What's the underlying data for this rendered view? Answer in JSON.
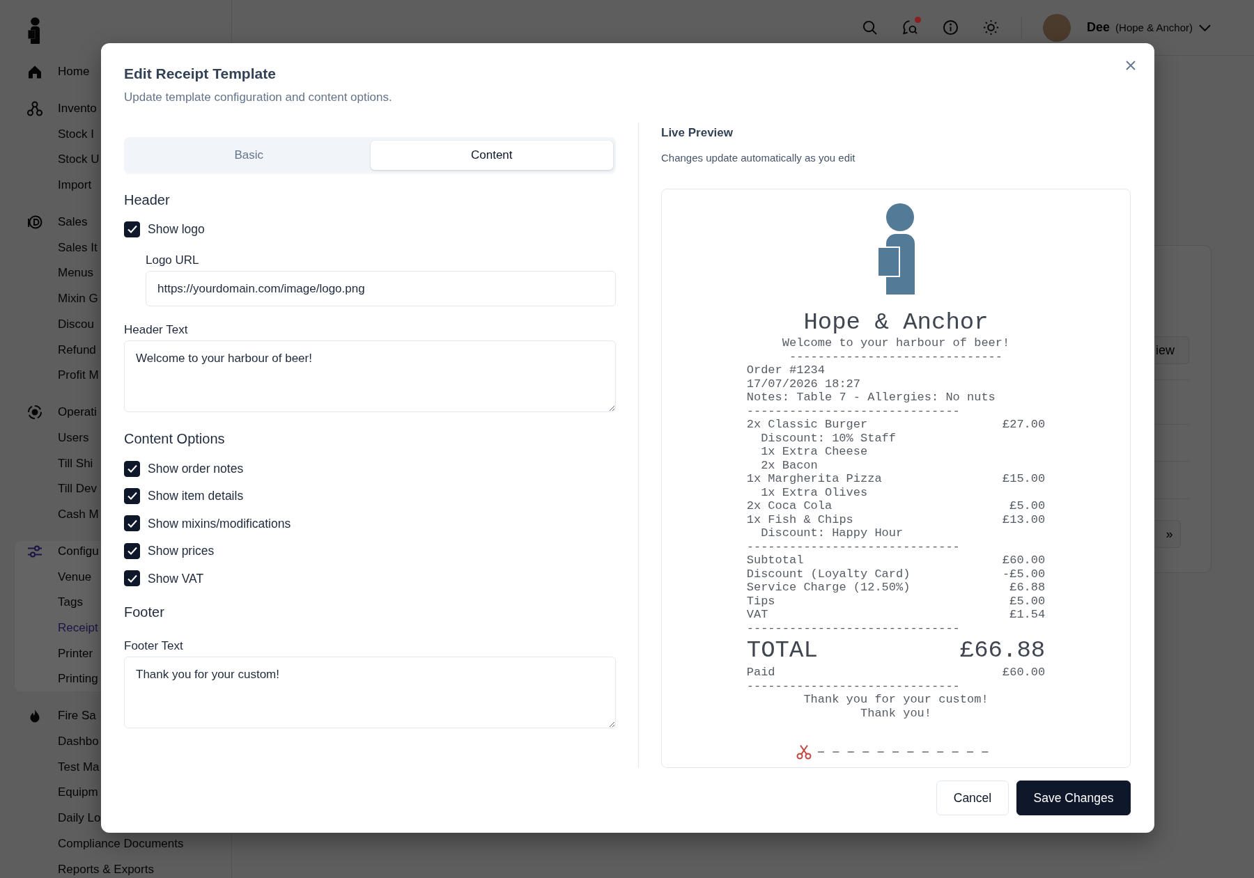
{
  "sidebar": {
    "items": [
      {
        "label": "Home",
        "selected": false
      },
      {
        "label": "Invento",
        "selected": false,
        "children": [
          {
            "label": "Stock I",
            "selected": false
          },
          {
            "label": "Stock U",
            "selected": false
          },
          {
            "label": "Import",
            "selected": false
          }
        ]
      },
      {
        "label": "Sales",
        "selected": false,
        "children": [
          {
            "label": "Sales It",
            "selected": false
          },
          {
            "label": "Menus",
            "selected": false
          },
          {
            "label": "Mixin G",
            "selected": false
          },
          {
            "label": "Discou",
            "selected": false
          },
          {
            "label": "Refund",
            "selected": false
          },
          {
            "label": "Profit M",
            "selected": false
          }
        ]
      },
      {
        "label": "Operati",
        "selected": false,
        "children": [
          {
            "label": "Users",
            "selected": false
          },
          {
            "label": "Till Shi",
            "selected": false
          },
          {
            "label": "Till Dev",
            "selected": false
          },
          {
            "label": "Cash M",
            "selected": false
          }
        ]
      },
      {
        "label": "Configu",
        "selected": false,
        "children": [
          {
            "label": "Venue",
            "selected": false
          },
          {
            "label": "Tags",
            "selected": false
          },
          {
            "label": "Receipt",
            "selected": true
          },
          {
            "label": "Printer",
            "selected": false
          },
          {
            "label": "Printing",
            "selected": false
          }
        ]
      },
      {
        "label": "Fire Sa",
        "selected": false,
        "children": [
          {
            "label": "Dashbo",
            "selected": false
          },
          {
            "label": "Test Ma",
            "selected": false
          },
          {
            "label": "Equipm",
            "selected": false
          },
          {
            "label": "Daily Lo",
            "selected": false
          },
          {
            "label": "Compliance Documents",
            "selected": false
          },
          {
            "label": "Reports & Exports",
            "selected": false
          }
        ]
      }
    ]
  },
  "top_bar": {
    "notification_dot": true,
    "user_name": "Dee",
    "venue": "(Hope & Anchor)"
  },
  "background_card": {
    "view_button": "iew",
    "next_button": "»"
  },
  "dialog": {
    "title": "Edit Receipt Template",
    "subtitle": "Update template configuration and content options.",
    "tabs": [
      {
        "label": "Basic",
        "selected": false
      },
      {
        "label": "Content",
        "selected": true
      }
    ],
    "header_section": {
      "heading": "Header",
      "show_logo": {
        "label": "Show logo",
        "checked": true
      },
      "logo_url": {
        "label": "Logo URL",
        "value": "https://yourdomain.com/image/logo.png"
      },
      "header_text": {
        "label": "Header Text",
        "value": "Welcome to your harbour of beer!"
      }
    },
    "content_options": {
      "heading": "Content Options",
      "options": [
        {
          "label": "Show order notes",
          "checked": true
        },
        {
          "label": "Show item details",
          "checked": true
        },
        {
          "label": "Show mixins/modifications",
          "checked": true
        },
        {
          "label": "Show prices",
          "checked": true
        },
        {
          "label": "Show VAT",
          "checked": true
        }
      ]
    },
    "footer_section": {
      "heading": "Footer",
      "footer_text": {
        "label": "Footer Text",
        "value": "Thank you for your custom!"
      }
    },
    "preview": {
      "title": "Live Preview",
      "hint": "Changes update automatically as you edit",
      "receipt": {
        "name": "Hope & Anchor",
        "tagline": "Welcome to your harbour of beer!",
        "header_rule": "------------------------------",
        "lines": [
          {
            "kind": "text",
            "text": "Order #1234"
          },
          {
            "kind": "text",
            "text": "17/07/2026 18:27"
          },
          {
            "kind": "text",
            "text": "Notes: Table 7 - Allergies: No nuts"
          },
          {
            "kind": "rule",
            "text": "------------------------------"
          },
          {
            "kind": "item",
            "text": "2x Classic Burger",
            "amount": "£27.00"
          },
          {
            "kind": "sub",
            "text": "Discount: 10% Staff"
          },
          {
            "kind": "sub",
            "text": "1x Extra Cheese"
          },
          {
            "kind": "sub",
            "text": "2x Bacon"
          },
          {
            "kind": "item",
            "text": "1x Margherita Pizza",
            "amount": "£15.00"
          },
          {
            "kind": "sub",
            "text": "1x Extra Olives"
          },
          {
            "kind": "item",
            "text": "2x Coca Cola",
            "amount": "£5.00"
          },
          {
            "kind": "item",
            "text": "1x Fish & Chips",
            "amount": "£13.00"
          },
          {
            "kind": "sub",
            "text": "Discount: Happy Hour"
          },
          {
            "kind": "rule",
            "text": "------------------------------"
          },
          {
            "kind": "item",
            "text": "Subtotal",
            "amount": "£60.00"
          },
          {
            "kind": "item",
            "text": "Discount (Loyalty Card)",
            "amount": "-£5.00"
          },
          {
            "kind": "item",
            "text": "Service Charge (12.50%)",
            "amount": "£6.88"
          },
          {
            "kind": "item",
            "text": "Tips",
            "amount": "£5.00"
          },
          {
            "kind": "item",
            "text": "VAT",
            "amount": "£1.54"
          },
          {
            "kind": "rule",
            "text": "------------------------------"
          },
          {
            "kind": "total",
            "text": "TOTAL",
            "amount": "£66.88"
          },
          {
            "kind": "item",
            "text": "Paid",
            "amount": "£60.00"
          },
          {
            "kind": "rule",
            "text": "------------------------------"
          },
          {
            "kind": "center",
            "text": "Thank you for your custom!"
          },
          {
            "kind": "center",
            "text": "Thank you!"
          }
        ]
      }
    },
    "buttons": [
      {
        "label": "Cancel",
        "kind": "secondary"
      },
      {
        "label": "Save Changes",
        "kind": "primary"
      }
    ]
  }
}
